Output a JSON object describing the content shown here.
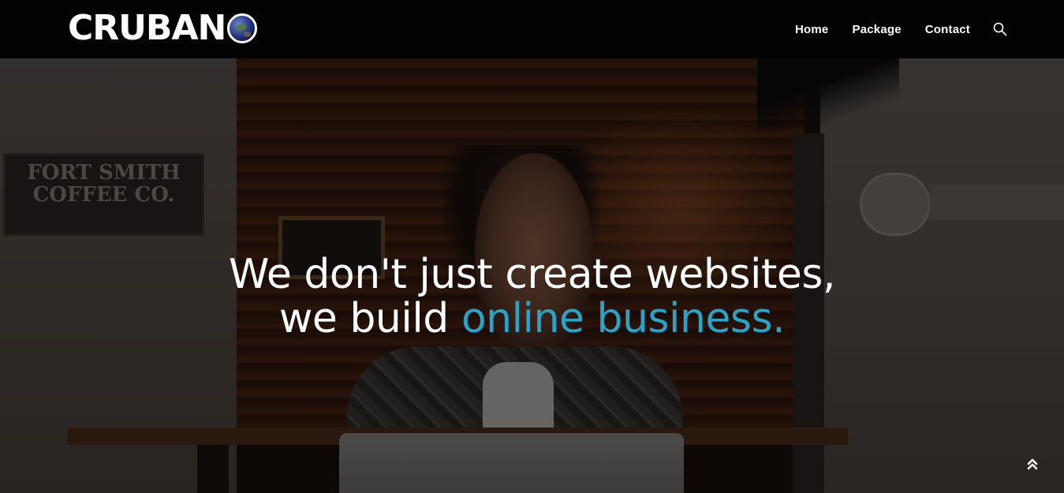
{
  "header": {
    "logo_text": "CRUBAN",
    "logo_globe_icon": "globe-icon",
    "nav": [
      {
        "label": "Home"
      },
      {
        "label": "Package"
      },
      {
        "label": "Contact"
      }
    ],
    "search_icon": "search-icon"
  },
  "hero": {
    "line1": "We don't just create websites,",
    "line2_plain": "we build ",
    "line2_accent": "online business.",
    "background_sign": {
      "line1": "FORT SMITH",
      "line2": "COFFEE CO."
    },
    "accent_color": "#2aa3c7"
  },
  "scroll_top_icon": "double-chevron-up-icon"
}
